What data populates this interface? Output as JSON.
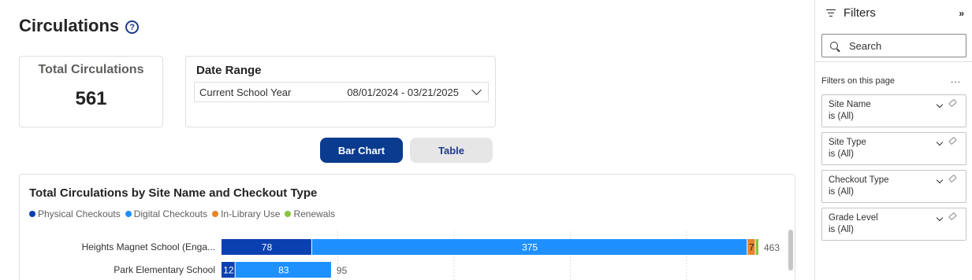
{
  "page": {
    "title": "Circulations",
    "help_icon": "question-circle-icon"
  },
  "total_card": {
    "label": "Total Circulations",
    "value": "561"
  },
  "date_range": {
    "label": "Date Range",
    "selected": "Current School Year",
    "range": "08/01/2024 - 03/21/2025"
  },
  "view_toggle": {
    "bar_chart_label": "Bar Chart",
    "table_label": "Table",
    "active": "Bar Chart"
  },
  "colors": {
    "physical": "#0b40b0",
    "digital": "#1e90ff",
    "in_library": "#e8832a",
    "renewals": "#8ac43f",
    "primary_button": "#0b3b8f"
  },
  "chart_data": {
    "type": "bar",
    "orientation": "horizontal-stacked",
    "title": "Total Circulations by Site Name and Checkout Type",
    "legend_position": "top-left",
    "grid": true,
    "categories": [
      "Heights Magnet School (Enga...",
      "Park Elementary School"
    ],
    "series": [
      {
        "name": "Physical Checkouts",
        "color": "#0b40b0",
        "values": [
          78,
          12
        ]
      },
      {
        "name": "Digital Checkouts",
        "color": "#1e90ff",
        "values": [
          375,
          83
        ]
      },
      {
        "name": "In-Library Use",
        "color": "#e8832a",
        "values": [
          7,
          0
        ]
      },
      {
        "name": "Renewals",
        "color": "#8ac43f",
        "values": [
          3,
          0
        ]
      }
    ],
    "totals": [
      463,
      95
    ],
    "xlim": [
      0,
      463
    ]
  },
  "filters": {
    "title": "Filters",
    "collapse_icon": "double-chevron-right-icon",
    "search_placeholder": "Search",
    "section_label": "Filters on this page",
    "more_label": "...",
    "items": [
      {
        "name": "Site Name",
        "value": "is (All)"
      },
      {
        "name": "Site Type",
        "value": "is (All)"
      },
      {
        "name": "Checkout Type",
        "value": "is (All)"
      },
      {
        "name": "Grade Level",
        "value": "is (All)"
      }
    ]
  }
}
